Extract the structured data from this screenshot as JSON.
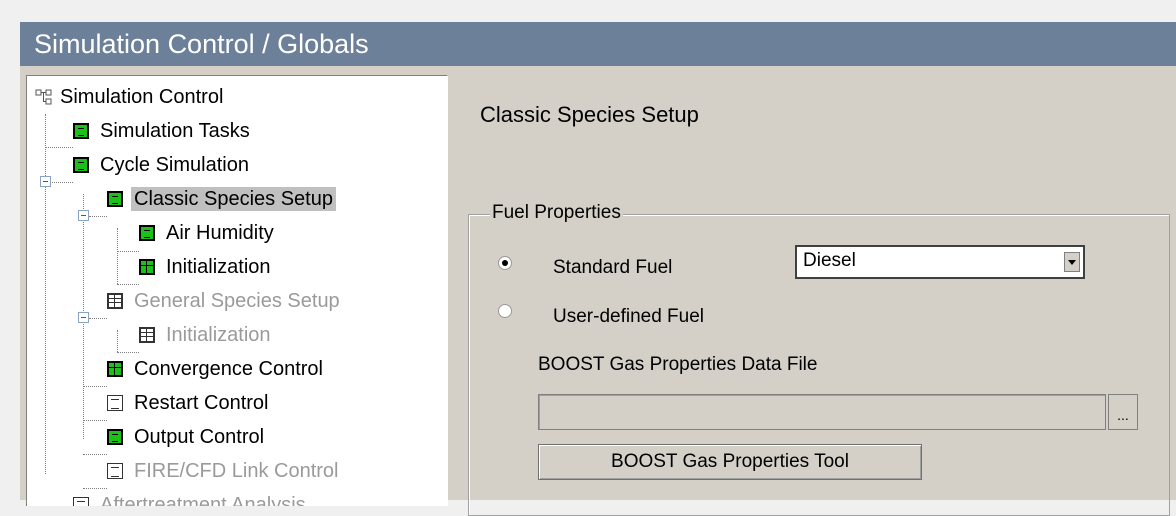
{
  "window": {
    "title": "Simulation Control / Globals"
  },
  "tree": {
    "root_label": "Simulation Control",
    "items": [
      {
        "label": "Simulation Tasks",
        "icon": "green-node-icon",
        "enabled": true
      },
      {
        "label": "Cycle Simulation",
        "icon": "green-node-icon",
        "enabled": true
      },
      {
        "label": "Classic Species Setup",
        "icon": "green-node-icon",
        "enabled": true,
        "selected": true
      },
      {
        "label": "Air Humidity",
        "icon": "green-node-icon",
        "enabled": true
      },
      {
        "label": "Initialization",
        "icon": "green-table-icon",
        "enabled": true
      },
      {
        "label": "General Species Setup",
        "icon": "table-icon",
        "enabled": false
      },
      {
        "label": "Initialization",
        "icon": "table-icon",
        "enabled": false
      },
      {
        "label": "Convergence Control",
        "icon": "green-table-icon",
        "enabled": true
      },
      {
        "label": "Restart Control",
        "icon": "white-node-icon",
        "enabled": true
      },
      {
        "label": "Output Control",
        "icon": "green-node-icon",
        "enabled": true
      },
      {
        "label": "FIRE/CFD Link Control",
        "icon": "white-node-icon",
        "enabled": false
      },
      {
        "label": "Aftertreatment Analysis",
        "icon": "white-node-icon",
        "enabled": false
      }
    ]
  },
  "panel": {
    "title": "Classic Species Setup",
    "fuel_group": {
      "legend": "Fuel Properties",
      "standard_fuel_label": "Standard Fuel",
      "standard_fuel_checked": true,
      "fuel_select_value": "Diesel",
      "user_defined_label": "User-defined Fuel",
      "user_defined_checked": false,
      "data_file_label": "BOOST Gas Properties Data File",
      "data_file_value": "",
      "browse_label": "...",
      "tool_button_label": "BOOST Gas Properties Tool"
    }
  },
  "colors": {
    "title_bar": "#6d8099",
    "panel_bg": "#d4d0c8",
    "tree_bg": "#ffffff",
    "icon_green": "#19c119",
    "disabled_text": "#9a9a9a"
  }
}
